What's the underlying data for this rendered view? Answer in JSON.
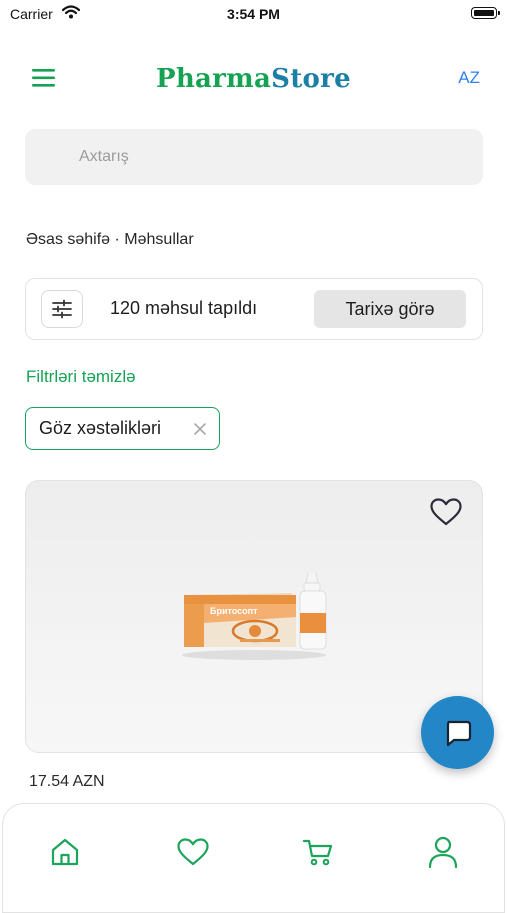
{
  "status_bar": {
    "carrier": "Carrier",
    "time": "3:54 PM"
  },
  "header": {
    "brand_part1": "Pharma",
    "brand_part2": "Store",
    "language": "AZ"
  },
  "search": {
    "placeholder": "Axtarış"
  },
  "breadcrumb": {
    "home": "Əsas səhifə",
    "separator": " · ",
    "current": "Məhsullar"
  },
  "filter_bar": {
    "result_count": "120 məhsul tapıldı",
    "sort_label": "Tarixə görə"
  },
  "filters": {
    "clear_label": "Filtrləri təmizlə",
    "chips": [
      "Göz xəstəlikləri"
    ]
  },
  "product": {
    "price": "17.54 AZN",
    "image_label": "Бритосопт"
  },
  "bottom_nav": {
    "items": [
      "home-icon",
      "heart-icon",
      "cart-icon",
      "user-icon"
    ]
  },
  "colors": {
    "brand_green": "#15a253",
    "brand_blue": "#1d7fa6",
    "link_blue": "#2f80ed",
    "fab_blue": "#2387c7",
    "chip_border": "#1aa35b"
  }
}
